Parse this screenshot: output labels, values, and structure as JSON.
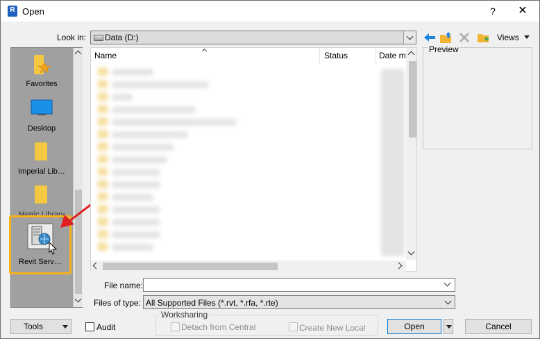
{
  "window": {
    "app_icon_letter": "R",
    "title": "Open",
    "help_label": "?",
    "close_label": "✕"
  },
  "lookin": {
    "label": "Look in:",
    "value": "Data (D:)",
    "views_label": "Views"
  },
  "places": [
    {
      "label": "Favorites",
      "icon": "favorites-icon"
    },
    {
      "label": "Desktop",
      "icon": "desktop-icon"
    },
    {
      "label": "Imperial Lib…",
      "icon": "folder-icon"
    },
    {
      "label": "Metric Library",
      "icon": "folder-icon"
    },
    {
      "label": "Revit Serv…",
      "icon": "revit-server-icon"
    }
  ],
  "filelist": {
    "columns": [
      "Name",
      "Status",
      "Date m"
    ],
    "rows_blurred_count_note": ""
  },
  "preview": {
    "label": "Preview"
  },
  "file_name": {
    "label": "File name:",
    "value": ""
  },
  "file_type": {
    "label": "Files of type:",
    "value": "All Supported Files (*.rvt, *.rfa, *.rte)"
  },
  "bottom": {
    "tools_label": "Tools",
    "audit_label": "Audit",
    "worksharing_label": "Worksharing",
    "detach_label": "Detach from Central",
    "create_local_label": "Create New Local",
    "open_label": "Open",
    "cancel_label": "Cancel"
  },
  "colors": {
    "highlight": "#f5b21a",
    "annotation_arrow": "#e02020",
    "revit_icon": "#1e5fbf"
  }
}
